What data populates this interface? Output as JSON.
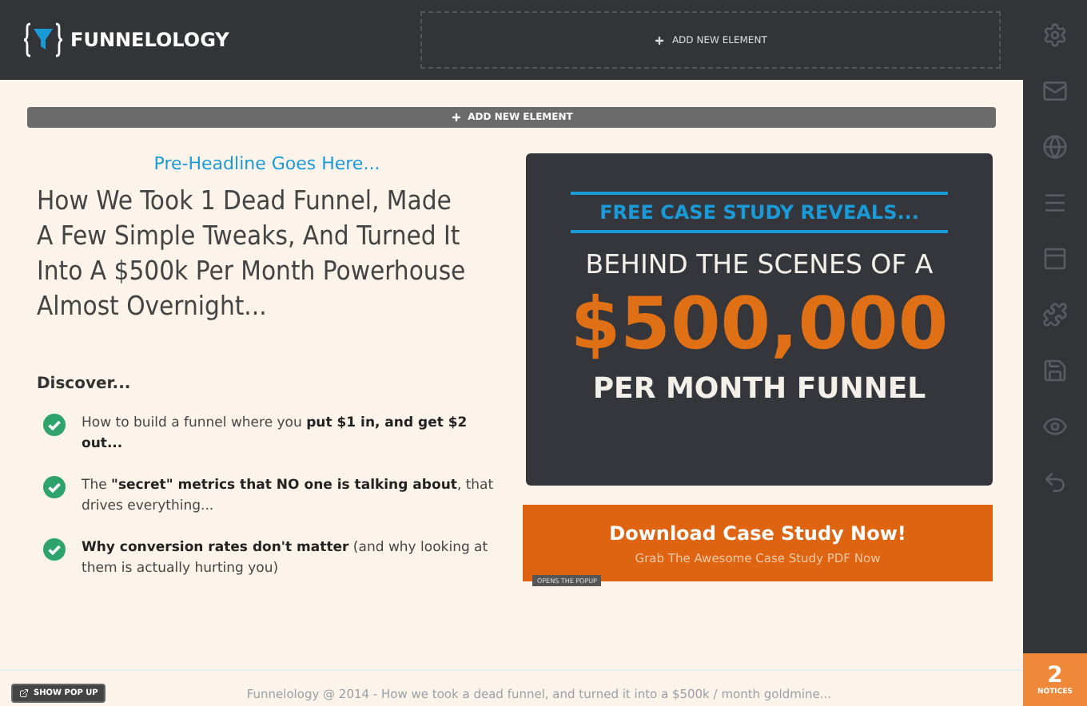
{
  "header": {
    "logo": "FUNNELOLOGY",
    "add_element": "ADD NEW ELEMENT"
  },
  "toolbar": {
    "add_element": "ADD NEW ELEMENT"
  },
  "left": {
    "pre_headline": "Pre-Headline Goes Here...",
    "headline": "How We Took 1 Dead Funnel, Made A Few Simple Tweaks, And Turned It Into A $500k Per Month Powerhouse Almost Overnight...",
    "discover": "Discover...",
    "bullets": [
      "How to build a funnel where you **put $1 in, and get $2 out...**",
      "The **\"secret\" metrics that NO one is talking about**, that drives everything...",
      "**Why conversion rates don't matter** (and why looking at them is actually hurting you)"
    ]
  },
  "card": {
    "kicker": "FREE CASE STUDY REVEALS...",
    "line1": "BEHIND THE SCENES OF A",
    "amount": "$500,000",
    "line2": "PER MONTH FUNNEL"
  },
  "cta": {
    "title": "Download Case Study Now!",
    "subtitle": "Grab The Awesome Case Study PDF Now",
    "tag": "OPENS THE POPUP"
  },
  "show_popup": "SHOW POP UP",
  "footer": "Funnelology @ 2014 - How we took a dead funnel, and turned it into a $500k / month goldmine...",
  "sidebar": {
    "tools": [
      {
        "kind": "settings"
      },
      {
        "kind": "mail"
      },
      {
        "kind": "globe"
      },
      {
        "kind": "menu"
      },
      {
        "kind": "layout"
      },
      {
        "kind": "puzzle"
      },
      {
        "kind": "save"
      },
      {
        "kind": "eye"
      },
      {
        "kind": "undo"
      }
    ],
    "notices": {
      "count": "2",
      "label": "NOTICES"
    }
  }
}
